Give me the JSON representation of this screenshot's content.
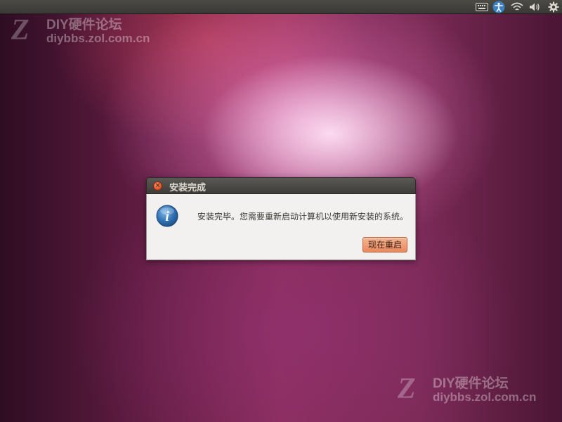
{
  "watermark": {
    "logo_glyph": "Z",
    "title": "DIY硬件论坛",
    "url": "diybbs.zol.com.cn"
  },
  "top_panel": {
    "indicators": [
      "keyboard-icon",
      "accessibility-icon",
      "wifi-icon",
      "volume-icon",
      "gear-icon"
    ]
  },
  "dialog": {
    "title": "安装完成",
    "message": "安装完毕。您需要重新启动计算机以使用新安装的系统。",
    "restart_label": "现在重启",
    "close_glyph": "×",
    "info_glyph": "i"
  },
  "colors": {
    "accent_button": "#ea875e",
    "close_button": "#e2582a",
    "info_icon": "#2f6fb0",
    "panel": "#3c3b37"
  }
}
